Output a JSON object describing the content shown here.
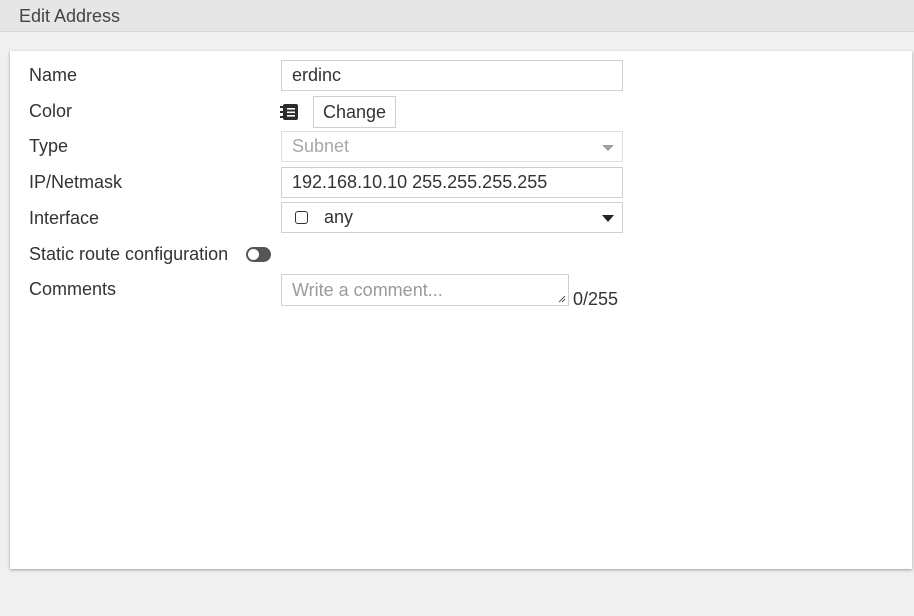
{
  "window": {
    "title": "Edit Address"
  },
  "form": {
    "name": {
      "label": "Name",
      "value": "erdinc"
    },
    "color": {
      "label": "Color",
      "button_label": "Change",
      "icon": "color-book-icon"
    },
    "type": {
      "label": "Type",
      "value": "Subnet"
    },
    "ip_netmask": {
      "label": "IP/Netmask",
      "value": "192.168.10.10 255.255.255.255"
    },
    "interface": {
      "label": "Interface",
      "value": "any",
      "icon": "interface-box-icon"
    },
    "static_route": {
      "label": "Static route configuration",
      "enabled": false
    },
    "comments": {
      "label": "Comments",
      "placeholder": "Write a comment...",
      "counter": "0/255"
    }
  }
}
